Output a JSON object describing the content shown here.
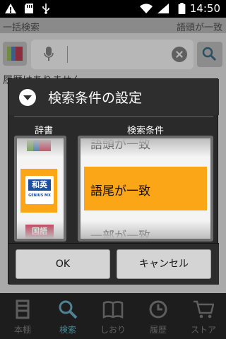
{
  "status_bar": {
    "time": "14:50",
    "icons": [
      "warning-icon",
      "sd-card-icon",
      "usb-icon",
      "wifi-icon",
      "signal-icon",
      "battery-icon"
    ]
  },
  "app": {
    "search_scope_left": "一括検索",
    "search_scope_right": "語頭が一致",
    "history_text": "履歴はありません",
    "search_input_value": ""
  },
  "dialog": {
    "title": "検索条件の設定",
    "dictionary_header": "辞書",
    "condition_header": "検索条件",
    "dictionaries": [
      {
        "name": "books-icon"
      },
      {
        "name": "waei-dictionary-icon",
        "label": "和英",
        "sub": "GENIUS MX"
      },
      {
        "name": "kokugo-dictionary-icon",
        "label": "国語"
      }
    ],
    "conditions": [
      "語頭が一致",
      "語尾が一致",
      "一部が一致"
    ],
    "selected_condition": "語尾が一致",
    "ok_label": "OK",
    "cancel_label": "キャンセル"
  },
  "bottom_nav": {
    "items": [
      {
        "label": "本棚",
        "icon": "bookshelf-icon"
      },
      {
        "label": "検索",
        "icon": "search-icon",
        "active": true
      },
      {
        "label": "しおり",
        "icon": "bookmark-icon"
      },
      {
        "label": "履歴",
        "icon": "history-icon"
      },
      {
        "label": "ストア",
        "icon": "cart-icon"
      }
    ]
  },
  "colors": {
    "accent_orange": "#fba617",
    "active_nav": "#4f8294"
  }
}
